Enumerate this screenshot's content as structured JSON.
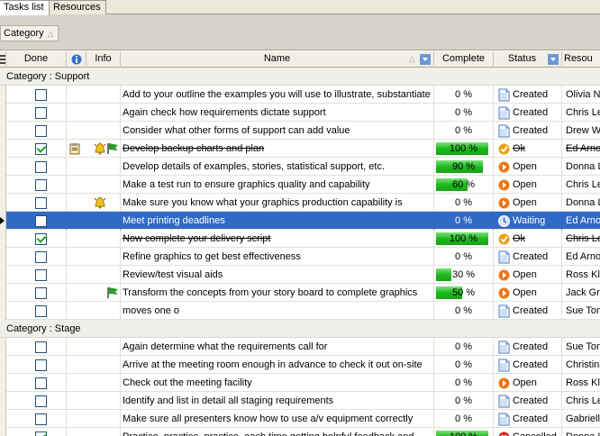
{
  "tabs": [
    "Tasks list",
    "Resources"
  ],
  "group_chip": "Category",
  "columns": {
    "done": "Done",
    "info": "Info",
    "name": "Name",
    "complete": "Complete",
    "status": "Status",
    "resource": "Resou"
  },
  "categories": [
    {
      "label": "Category : Support",
      "rows": [
        {
          "done": false,
          "name": "Add to your outline the examples you will use to illustrate, substantiate or",
          "pct": "0 %",
          "pct_value": 0,
          "status": "Created",
          "status_icon": "document-icon",
          "resource": "Olivia No",
          "info": []
        },
        {
          "done": false,
          "name": "Again check how requirements dictate support",
          "pct": "0 %",
          "pct_value": 0,
          "status": "Created",
          "status_icon": "document-icon",
          "resource": "Chris Lee",
          "info": []
        },
        {
          "done": false,
          "name": "Consider what other forms of support can add value",
          "pct": "0 %",
          "pct_value": 0,
          "status": "Created",
          "status_icon": "document-icon",
          "resource": "Drew Wh",
          "info": []
        },
        {
          "done": true,
          "name": "Develop backup charts and plan",
          "pct": "100 %",
          "pct_value": 100,
          "status": "Ok",
          "status_icon": "ok-icon",
          "resource": "Ed Arnol",
          "strike": true,
          "info": [
            "clipboard-icon",
            "alarm-bell-icon",
            "green-flag-icon"
          ]
        },
        {
          "done": false,
          "name": "Develop details of examples, stories, statistical support, etc.",
          "pct": "90 %",
          "pct_value": 90,
          "status": "Open",
          "status_icon": "open-arrow-icon",
          "resource": "Donna Le",
          "info": []
        },
        {
          "done": false,
          "name": "Make a test run to ensure graphics quality and capability",
          "pct": "60 %",
          "pct_value": 60,
          "status": "Open",
          "status_icon": "open-arrow-icon",
          "resource": "Chris Lee",
          "info": []
        },
        {
          "done": false,
          "name": "Make sure you know what your graphics production capability is",
          "pct": "0 %",
          "pct_value": 0,
          "status": "Open",
          "status_icon": "open-arrow-icon",
          "resource": "Donna Le",
          "info": [
            "alarm-bell-icon"
          ]
        },
        {
          "done": false,
          "name": "Meet printing deadlines",
          "pct": "0 %",
          "pct_value": 0,
          "status": "Waiting",
          "status_icon": "waiting-clock-icon",
          "resource": "Ed Arnol",
          "selected": true,
          "info": []
        },
        {
          "done": true,
          "name": "Now complete your delivery script",
          "pct": "100 %",
          "pct_value": 100,
          "status": "Ok",
          "status_icon": "ok-icon",
          "resource": "Chris Le",
          "strike": true,
          "info": []
        },
        {
          "done": false,
          "name": "Refine graphics to get best effectiveness",
          "pct": "0 %",
          "pct_value": 0,
          "status": "Created",
          "status_icon": "document-icon",
          "resource": "Ed Arnol",
          "info": []
        },
        {
          "done": false,
          "name": "Review/test visual aids",
          "pct": "30 %",
          "pct_value": 30,
          "status": "Open",
          "status_icon": "open-arrow-icon",
          "resource": "Ross Klin",
          "info": []
        },
        {
          "done": false,
          "name": "Transform the concepts from your story board to complete graphics",
          "pct": "50 %",
          "pct_value": 50,
          "status": "Open",
          "status_icon": "open-arrow-icon",
          "resource": "Jack Gra",
          "info": [
            "green-flag-icon"
          ]
        },
        {
          "done": false,
          "name": "moves one o",
          "pct": "0 %",
          "pct_value": 0,
          "status": "Created",
          "status_icon": "document-icon",
          "resource": "Sue Tom",
          "info": []
        }
      ]
    },
    {
      "label": "Category : Stage",
      "rows": [
        {
          "done": false,
          "name": "Again determine what the requirements call for",
          "pct": "0 %",
          "pct_value": 0,
          "status": "Created",
          "status_icon": "document-icon",
          "resource": "Sue Tom",
          "info": []
        },
        {
          "done": false,
          "name": "Arrive at the meeting room enough in advance to check it out on-site",
          "pct": "0 %",
          "pct_value": 0,
          "status": "Created",
          "status_icon": "document-icon",
          "resource": "Christina",
          "info": []
        },
        {
          "done": false,
          "name": "Check out the meeting facility",
          "pct": "0 %",
          "pct_value": 0,
          "status": "Open",
          "status_icon": "open-arrow-icon",
          "resource": "Ross Klin",
          "info": []
        },
        {
          "done": false,
          "name": "Identify and list in detail all staging requirements",
          "pct": "0 %",
          "pct_value": 0,
          "status": "Created",
          "status_icon": "document-icon",
          "resource": "Chris Lee",
          "info": []
        },
        {
          "done": false,
          "name": "Make sure all presenters know how to use a/v equipment correctly",
          "pct": "0 %",
          "pct_value": 0,
          "status": "Created",
          "status_icon": "document-icon",
          "resource": "Gabriella",
          "info": []
        },
        {
          "done": true,
          "name": "Practice, practice, practice, each time getting helpful feedback and",
          "pct": "100 %",
          "pct_value": 100,
          "status": "Cancelled",
          "status_icon": "cancelled-icon",
          "resource": "Donna L",
          "info": []
        }
      ]
    }
  ]
}
